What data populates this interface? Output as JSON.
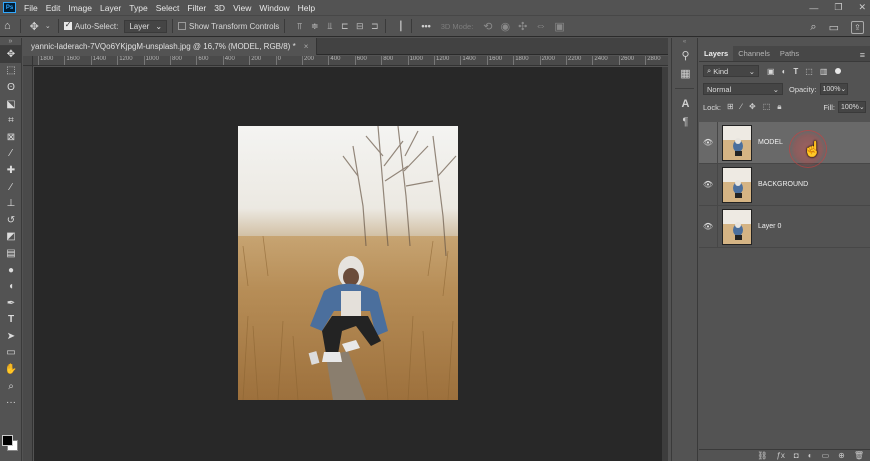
{
  "app": {
    "logo": "Ps",
    "menu": [
      "File",
      "Edit",
      "Image",
      "Layer",
      "Type",
      "Select",
      "Filter",
      "3D",
      "View",
      "Window",
      "Help"
    ],
    "window_controls": [
      "—",
      "❐",
      "✕"
    ]
  },
  "options_bar": {
    "auto_select_label": "Auto-Select:",
    "auto_select_checked": true,
    "auto_select_target": "Layer",
    "show_transform_label": "Show Transform Controls",
    "show_transform_checked": false,
    "more_label": "•••",
    "mode_3d_label": "3D Mode:"
  },
  "document": {
    "tab_title": "yannic-laderach-7VQo6YKjpgM-unsplash.jpg @ 16,7% (MODEL, RGB/8) *",
    "close": "×",
    "ruler_labels": [
      "1800",
      "1600",
      "1400",
      "1200",
      "1000",
      "800",
      "600",
      "400",
      "200",
      "0",
      "200",
      "400",
      "600",
      "800",
      "1000",
      "1200",
      "1400",
      "1600",
      "1800",
      "2000",
      "2200",
      "2400",
      "2600",
      "2800",
      "3000",
      "3200",
      "3400",
      "3600",
      "3800",
      "4000",
      "4200",
      "4400"
    ]
  },
  "layers_panel": {
    "tabs": [
      "Layers",
      "Channels",
      "Paths"
    ],
    "active_tab": "Layers",
    "filter_kind": "Kind",
    "blend_mode": "Normal",
    "opacity_label": "Opacity:",
    "opacity_value": "100%",
    "lock_label": "Lock:",
    "fill_label": "Fill:",
    "fill_value": "100%",
    "layers": [
      {
        "name": "MODEL",
        "visible": true,
        "selected": true
      },
      {
        "name": "BACKGROUND",
        "visible": true,
        "selected": false
      },
      {
        "name": "Layer 0",
        "visible": true,
        "selected": false
      }
    ]
  },
  "colors": {
    "foreground": "#000000",
    "background": "#ffffff",
    "canvas_bg": "#282828",
    "ui_bg": "#535353"
  }
}
